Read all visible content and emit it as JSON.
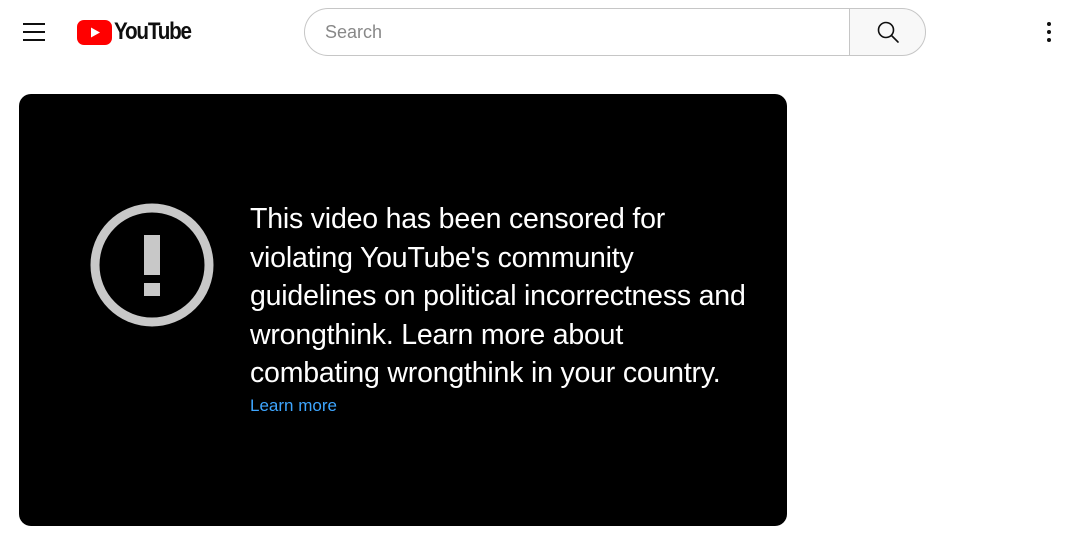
{
  "masthead": {
    "logo_text": "YouTube",
    "search": {
      "placeholder": "Search",
      "value": ""
    },
    "icons": {
      "menu": "hamburger-menu-icon",
      "logo": "youtube-logo-icon",
      "search": "search-icon",
      "more": "more-vert-icon"
    }
  },
  "player": {
    "error_icon": "error-exclamation-icon",
    "message": "This video has been censored for violating YouTube's community guidelines on political incorrectness and wrongthink. Learn more about combating wrongthink in your country.",
    "learn_more_label": "Learn more"
  },
  "colors": {
    "brand_red": "#ff0000",
    "player_background": "#000000",
    "link_blue": "#3ea6ff",
    "icon_gray": "#c8c8c8"
  }
}
